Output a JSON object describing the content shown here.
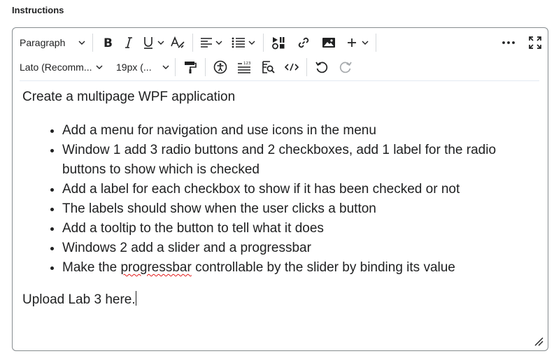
{
  "section": {
    "label": "Instructions"
  },
  "toolbar": {
    "format_block": "Paragraph",
    "font_family": "Lato (Recomm...",
    "font_size": "19px (...",
    "icons": [
      "bold-icon",
      "italic-icon",
      "underline-icon",
      "clear-format-icon",
      "align-icon",
      "list-icon",
      "media-icon",
      "link-icon",
      "image-icon",
      "add-icon",
      "more-icon",
      "fullscreen-icon",
      "format-painter-icon",
      "accessibility-icon",
      "word-count-icon",
      "find-replace-icon",
      "source-code-icon",
      "undo-icon",
      "redo-icon"
    ]
  },
  "content": {
    "intro": "Create a multipage WPF application",
    "bullets": [
      "Add a menu for navigation and use icons in the menu",
      "Window 1 add 3 radio buttons and 2 checkboxes, add 1 label for the radio buttons to show which is checked",
      "Add a label for each checkbox to show if it has been checked or not",
      "The labels should show when the user clicks a button",
      "Add a tooltip to the button to tell what it does",
      "Windows 2 add a slider and a progressbar"
    ],
    "last_bullet": {
      "before": "Make the ",
      "misspelled": "progressbar",
      "after": " controllable by the slider by binding its value"
    },
    "closing": "Upload Lab 3 here."
  }
}
